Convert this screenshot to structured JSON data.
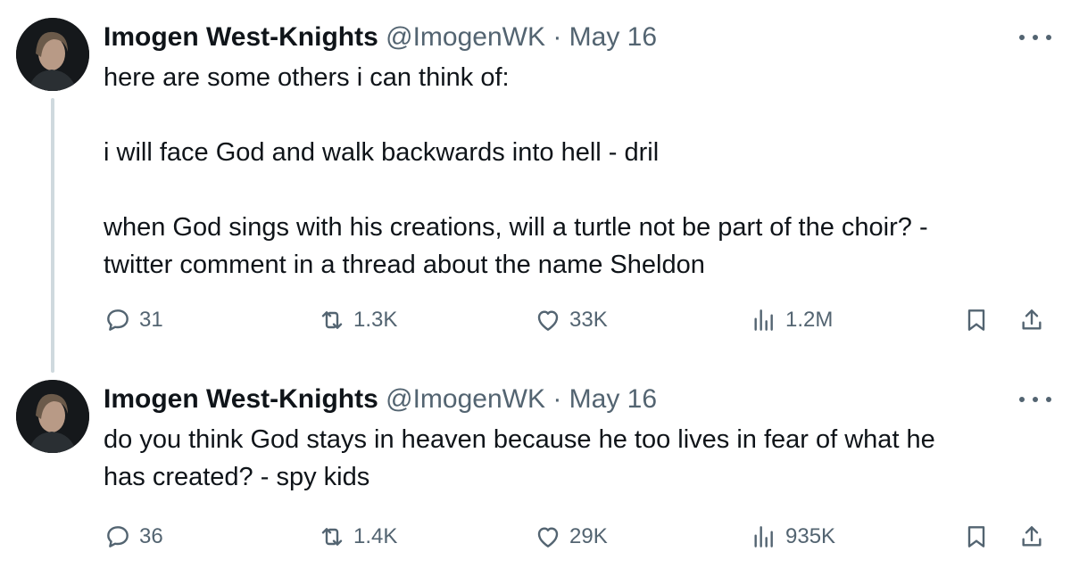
{
  "tweets": [
    {
      "author": {
        "name": "Imogen West-Knights",
        "handle": "@ImogenWK",
        "separator": "·",
        "date": "May 16"
      },
      "text_lines": [
        "here are some others i can think of:",
        "",
        "i will face God and walk backwards into hell - dril",
        "",
        "when God sings with his creations, will a turtle not be part of the choir? -",
        "twitter comment in a thread about the name Sheldon"
      ],
      "stats": {
        "replies": "31",
        "reposts": "1.3K",
        "likes": "33K",
        "views": "1.2M"
      }
    },
    {
      "author": {
        "name": "Imogen West-Knights",
        "handle": "@ImogenWK",
        "separator": "·",
        "date": "May 16"
      },
      "text_lines": [
        "do you think God stays in heaven because he too lives in fear of what he",
        "has created? - spy kids"
      ],
      "stats": {
        "replies": "36",
        "reposts": "1.4K",
        "likes": "29K",
        "views": "935K"
      }
    }
  ],
  "icons": {
    "reply": "reply-icon",
    "repost": "repost-icon",
    "like": "heart-icon",
    "views": "views-icon",
    "bookmark": "bookmark-icon",
    "share": "share-icon",
    "more": "more-icon"
  },
  "colors": {
    "text": "#0f1419",
    "secondary": "#536471",
    "thread_line": "#cfd9de"
  }
}
